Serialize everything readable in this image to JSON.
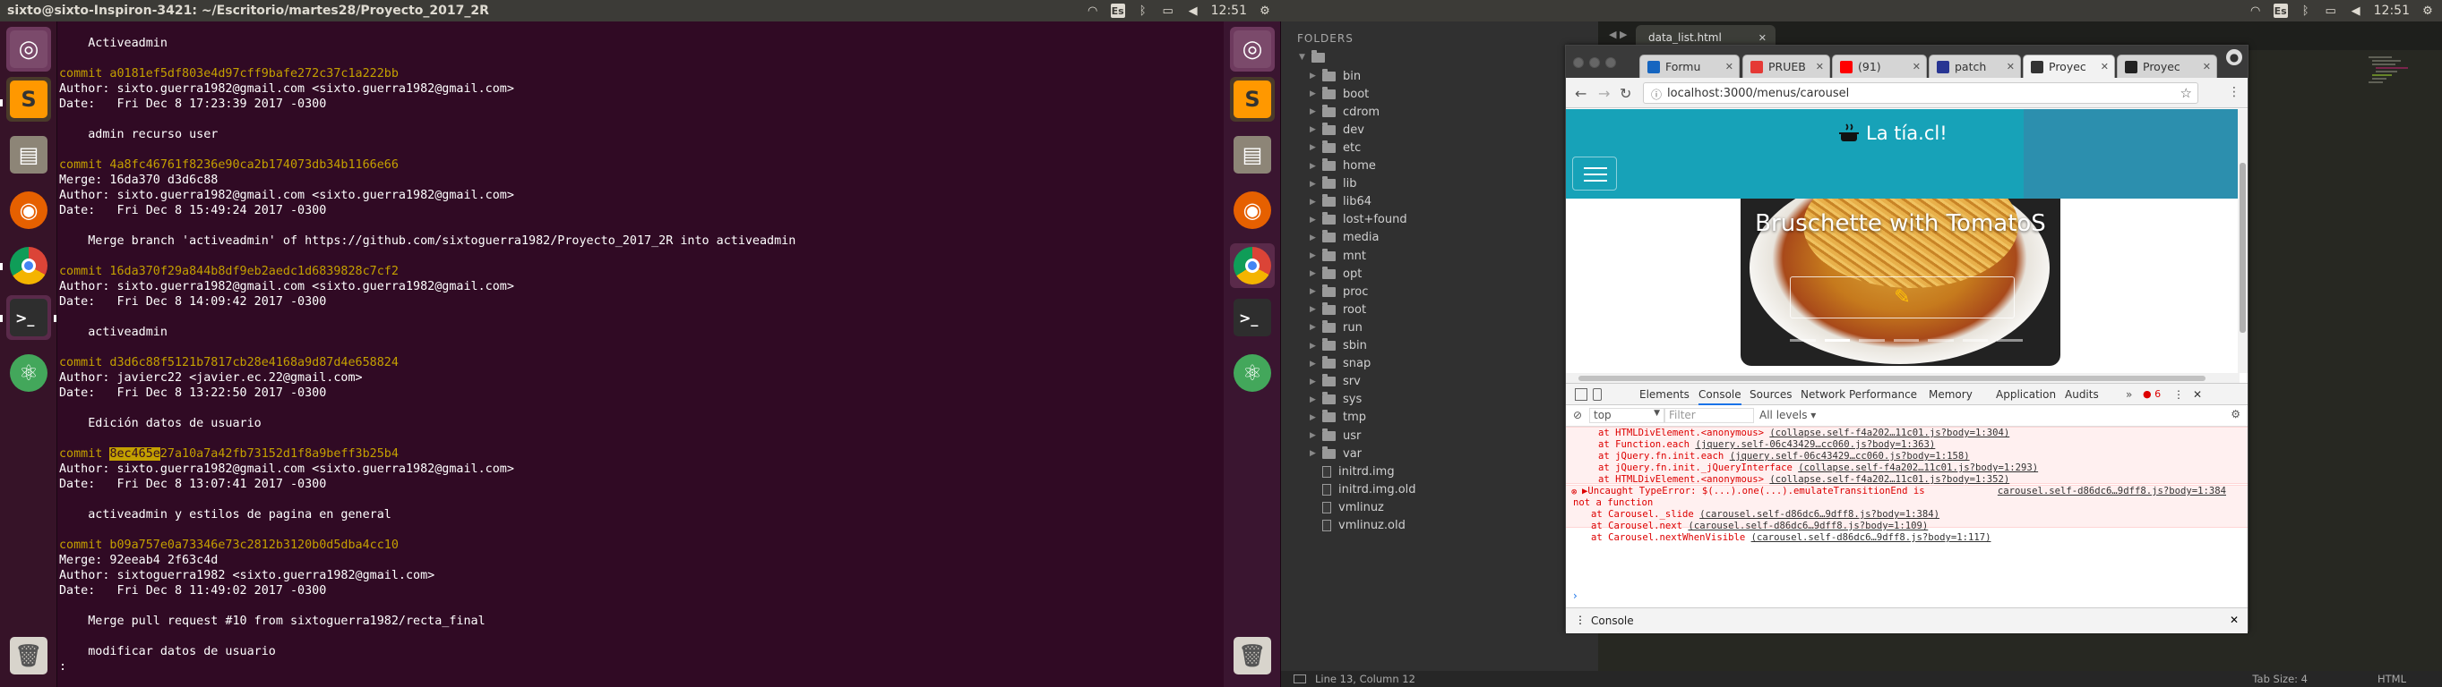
{
  "topbar_left": {
    "title": "sixto@sixto-Inspiron-3421: ~/Escritorio/martes28/Proyecto_2017_2R",
    "time": "12:51",
    "keyboard": "Es"
  },
  "topbar_right": {
    "time": "12:51",
    "keyboard": "Es"
  },
  "launcher_items": [
    "ubuntu-dash",
    "sublime-text",
    "files",
    "firefox",
    "chrome",
    "terminal",
    "atom",
    "trash"
  ],
  "terminal": {
    "lines": [
      {
        "t": "    Activeadmin",
        "c": ""
      },
      {
        "t": "",
        "c": ""
      },
      {
        "t": "commit a0181ef5df803e4d97cff9bafe272c37c1a222bb",
        "c": "commit"
      },
      {
        "t": "Author: sixto.guerra1982@gmail.com <sixto.guerra1982@gmail.com>",
        "c": ""
      },
      {
        "t": "Date:   Fri Dec 8 17:23:39 2017 -0300",
        "c": ""
      },
      {
        "t": "",
        "c": ""
      },
      {
        "t": "    admin recurso user",
        "c": ""
      },
      {
        "t": "",
        "c": ""
      },
      {
        "t": "commit 4a8fc46761f8236e90ca2b174073db34b1166e66",
        "c": "commit"
      },
      {
        "t": "Merge: 16da370 d3d6c88",
        "c": ""
      },
      {
        "t": "Author: sixto.guerra1982@gmail.com <sixto.guerra1982@gmail.com>",
        "c": ""
      },
      {
        "t": "Date:   Fri Dec 8 15:49:24 2017 -0300",
        "c": ""
      },
      {
        "t": "",
        "c": ""
      },
      {
        "t": "    Merge branch 'activeadmin' of https://github.com/sixtoguerra1982/Proyecto_2017_2R into activeadmin",
        "c": ""
      },
      {
        "t": "",
        "c": ""
      },
      {
        "t": "commit 16da370f29a844b8df9eb2aedc1d6839828c7cf2",
        "c": "commit"
      },
      {
        "t": "Author: sixto.guerra1982@gmail.com <sixto.guerra1982@gmail.com>",
        "c": ""
      },
      {
        "t": "Date:   Fri Dec 8 14:09:42 2017 -0300",
        "c": ""
      },
      {
        "t": "",
        "c": ""
      },
      {
        "t": "    activeadmin",
        "c": ""
      },
      {
        "t": "",
        "c": ""
      },
      {
        "t": "commit d3d6c88f5121b7817cb28e4168a9d87d4e658824",
        "c": "commit"
      },
      {
        "t": "Author: javierc22 <javier.ec.22@gmail.com>",
        "c": ""
      },
      {
        "t": "Date:   Fri Dec 8 13:22:50 2017 -0300",
        "c": ""
      },
      {
        "t": "",
        "c": ""
      },
      {
        "t": "    Edición datos de usuario",
        "c": ""
      },
      {
        "t": "",
        "c": ""
      },
      {
        "t": "commit ",
        "c": "commit",
        "hl": "8ec465e",
        "rest": "27a10a7a42fb73152d1f8a9beff3b25b4"
      },
      {
        "t": "Author: sixto.guerra1982@gmail.com <sixto.guerra1982@gmail.com>",
        "c": ""
      },
      {
        "t": "Date:   Fri Dec 8 13:07:41 2017 -0300",
        "c": ""
      },
      {
        "t": "",
        "c": ""
      },
      {
        "t": "    activeadmin y estilos de pagina en general",
        "c": ""
      },
      {
        "t": "",
        "c": ""
      },
      {
        "t": "commit b09a757e0a73346e73c2812b3120b0d5dba4cc10",
        "c": "commit"
      },
      {
        "t": "Merge: 92eeab4 2f63c4d",
        "c": ""
      },
      {
        "t": "Author: sixtoguerra1982 <sixto.guerra1982@gmail.com>",
        "c": ""
      },
      {
        "t": "Date:   Fri Dec 8 11:49:02 2017 -0300",
        "c": ""
      },
      {
        "t": "",
        "c": ""
      },
      {
        "t": "    Merge pull request #10 from sixtoguerra1982/recta_final",
        "c": ""
      },
      {
        "t": "",
        "c": ""
      },
      {
        "t": "    modificar datos de usuario",
        "c": ""
      },
      {
        "t": ":",
        "c": ""
      }
    ]
  },
  "sidebar": {
    "header": "FOLDERS",
    "folders": [
      "bin",
      "boot",
      "cdrom",
      "dev",
      "etc",
      "home",
      "lib",
      "lib64",
      "lost+found",
      "media",
      "mnt",
      "opt",
      "proc",
      "root",
      "run",
      "sbin",
      "snap",
      "srv",
      "sys",
      "tmp",
      "usr",
      "var"
    ],
    "files": [
      "initrd.img",
      "initrd.img.old",
      "vmlinuz",
      "vmlinuz.old"
    ]
  },
  "editor": {
    "tab": "data_list.html",
    "status_position": "Line 13, Column 12",
    "tab_size": "Tab Size: 4",
    "syntax": "HTML"
  },
  "chrome": {
    "tabs": [
      {
        "label": "Formu",
        "color": "#1565c0"
      },
      {
        "label": "PRUEB",
        "color": "#e53935"
      },
      {
        "label": "(91)",
        "color": "#ff0000"
      },
      {
        "label": "patch",
        "color": "#283593"
      },
      {
        "label": "Proyec",
        "color": "#333333"
      },
      {
        "label": "Proyec",
        "color": "#222222"
      }
    ],
    "url": "localhost:3000/menus/carousel",
    "page": {
      "brand": "La tía.cl!",
      "caption": "Bruschette with TomatoS"
    },
    "devtools": {
      "tabs": [
        "Elements",
        "Console",
        "Sources",
        "Network",
        "Performance",
        "Memory",
        "Application",
        "Audits"
      ],
      "active_tab": "Console",
      "error_count": "6",
      "context": "top",
      "filter_placeholder": "Filter",
      "levels": "All levels",
      "stack1": [
        {
          "t": "at HTMLDivElement.<anonymous> ",
          "l": "(collapse.self-f4a202…11c01.js?body=1:304)"
        },
        {
          "t": "at Function.each ",
          "l": "(jquery.self-06c43429…cc060.js?body=1:363)"
        },
        {
          "t": "at jQuery.fn.init.each ",
          "l": "(jquery.self-06c43429…cc060.js?body=1:158)"
        },
        {
          "t": "at jQuery.fn.init._jQueryInterface ",
          "l": "(collapse.self-f4a202…11c01.js?body=1:293)"
        },
        {
          "t": "at HTMLDivElement.<anonymous> ",
          "l": "(collapse.self-f4a202…11c01.js?body=1:352)"
        },
        {
          "t": "at Function.each ",
          "l": "(jquery.self-06c43429…cc060.js?body=1:363)"
        },
        {
          "t": "at jQuery.fn.init.each ",
          "l": "(jquery.self-06c43429…cc060.js?body=1:158)"
        }
      ],
      "error2_msg1": "▶Uncaught TypeError: $(...).one(...).emulateTransitionEnd is",
      "error2_msg2": "not a function",
      "error2_src": "carousel.self-d86dc6…9dff8.js?body=1:384",
      "stack2": [
        {
          "t": "at Carousel._slide ",
          "l": "(carousel.self-d86dc6…9dff8.js?body=1:384)"
        },
        {
          "t": "at Carousel.next ",
          "l": "(carousel.self-d86dc6…9dff8.js?body=1:109)"
        },
        {
          "t": "at Carousel.nextWhenVisible ",
          "l": "(carousel.self-d86dc6…9dff8.js?body=1:117)"
        }
      ],
      "drawer_label": "Console"
    }
  }
}
